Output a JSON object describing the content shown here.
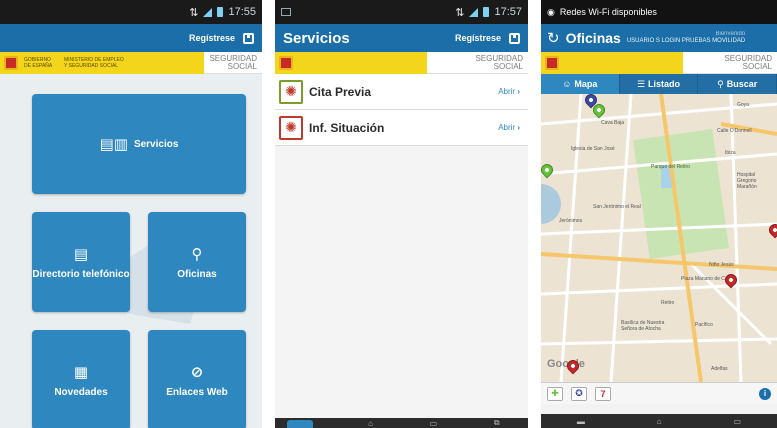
{
  "phone1": {
    "status_time": "17:55",
    "header_register": "Regístrese",
    "logo_gob_text": "GOBIERNO DE ESPAÑA",
    "logo_ministerio_text": "MINISTERIO DE EMPLEO Y SEGURIDAD SOCIAL",
    "logo_ss_text_1": "SEGURIDAD",
    "logo_ss_text_2": "SOCIAL",
    "tiles": {
      "servicios": "Servicios",
      "directorio": "Directorio telefónico",
      "oficinas": "Oficinas",
      "novedades": "Novedades",
      "enlaces": "Enlaces Web"
    }
  },
  "phone2": {
    "status_time": "17:57",
    "title": "Servicios",
    "header_register": "Regístrese",
    "logo_ss_text_1": "SEGURIDAD",
    "logo_ss_text_2": "SOCIAL",
    "items": [
      {
        "label": "Cita Previa",
        "action": "Abrir"
      },
      {
        "label": "Inf. Situación",
        "action": "Abrir"
      }
    ]
  },
  "phone3": {
    "wifi_notice": "Redes Wi-Fi disponibles",
    "title": "Oficinas",
    "welcome": "Bienvenido",
    "user": "USUARIO S LOGIN PRUEBAS MOVILIDAD",
    "logo_ss_text_1": "SEGURIDAD",
    "logo_ss_text_2": "SOCIAL",
    "tabs": [
      {
        "label": "Mapa",
        "icon": "person-icon"
      },
      {
        "label": "Listado",
        "icon": "list-icon"
      },
      {
        "label": "Buscar",
        "icon": "search-icon"
      }
    ],
    "map_labels": {
      "a": "Cava Baja",
      "b": "Iglesia de San José",
      "c": "Parque del Retiro",
      "d": "San Jerónimo el Real",
      "e": "Jerónimos",
      "f": "Calle O'Donnell",
      "g": "Ibiza",
      "h": "Niño Jesús",
      "i": "Plaza Mariano de Cavia",
      "j": "Retiro",
      "k": "Pacífico",
      "l": "Basílica de Nuestra Señora de Atocha",
      "m": "Adelfas",
      "n": "Goya",
      "google": "Google",
      "o": "Hospital Gregorio Marañón"
    }
  },
  "colors": {
    "primary": "#1b6ea7",
    "tile": "#2f87bf",
    "yellow": "#f3d51b",
    "pin_green": "#66c23a",
    "pin_red": "#c62828"
  }
}
